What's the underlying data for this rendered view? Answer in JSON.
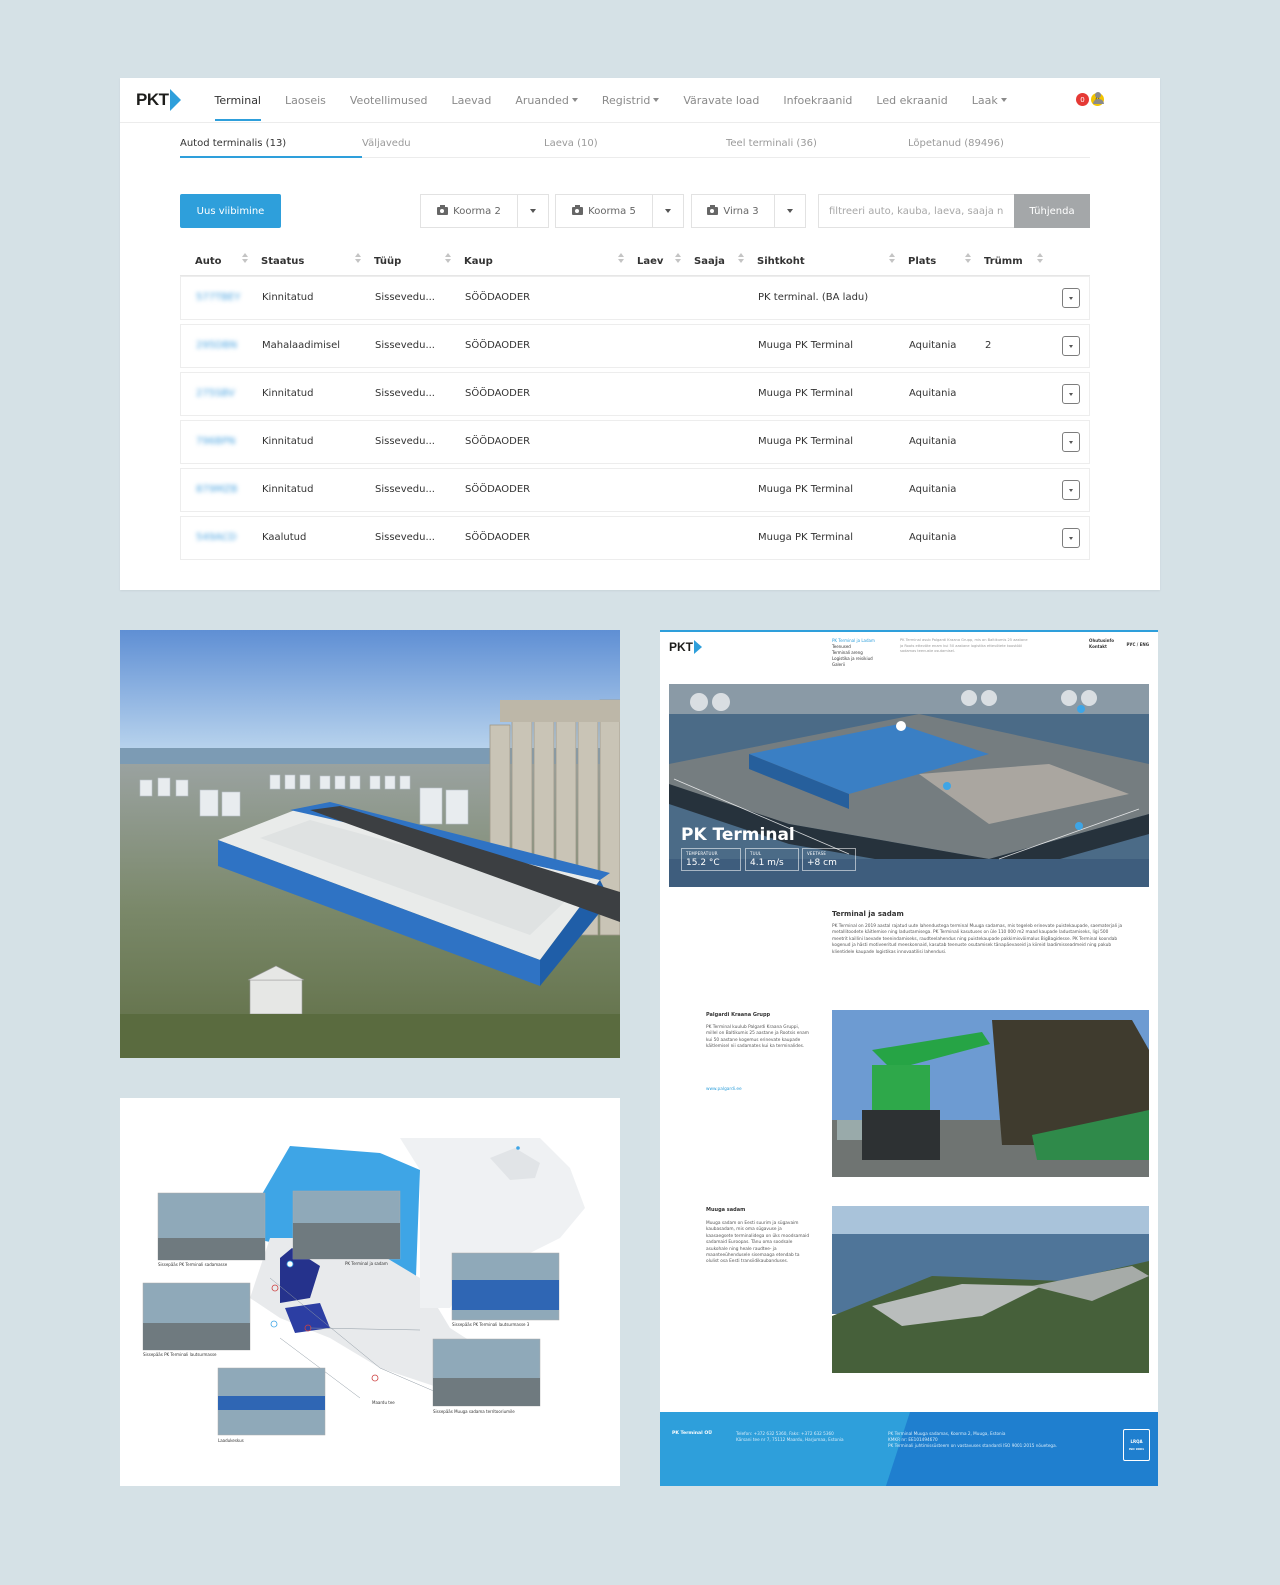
{
  "app": {
    "logo": "PKT",
    "nav": [
      {
        "label": "Terminal",
        "active": true,
        "dropdown": false
      },
      {
        "label": "Laoseis",
        "active": false,
        "dropdown": false
      },
      {
        "label": "Veotellimused",
        "active": false,
        "dropdown": false
      },
      {
        "label": "Laevad",
        "active": false,
        "dropdown": false
      },
      {
        "label": "Aruanded",
        "active": false,
        "dropdown": true
      },
      {
        "label": "Registrid",
        "active": false,
        "dropdown": true
      },
      {
        "label": "Väravate load",
        "active": false,
        "dropdown": false
      },
      {
        "label": "Infoekraanid",
        "active": false,
        "dropdown": false
      },
      {
        "label": "Led ekraanid",
        "active": false,
        "dropdown": false
      },
      {
        "label": "Laak",
        "active": false,
        "dropdown": true
      }
    ],
    "badges": {
      "red": "0",
      "yellow": "0"
    },
    "tabs": [
      {
        "label": "Autod terminalis (13)",
        "active": true
      },
      {
        "label": "Väljavedu",
        "active": false
      },
      {
        "label": "Laeva (10)",
        "active": false
      },
      {
        "label": "Teel terminali (36)",
        "active": false
      },
      {
        "label": "Lõpetanud (89496)",
        "active": false
      }
    ],
    "toolbar": {
      "new_button": "Uus viibimine",
      "splits": [
        "Koorma 2",
        "Koorma 5",
        "Virna 3"
      ],
      "filter_placeholder": "filtreeri auto, kauba, laeva, saaja nime järgi",
      "clear_button": "Tühjenda"
    },
    "table": {
      "columns": [
        "Auto",
        "Staatus",
        "Tüüp",
        "Kaup",
        "Laev",
        "Saaja",
        "Sihtkoht",
        "Plats",
        "Trümm"
      ],
      "rows": [
        {
          "auto": "577TBEY",
          "staatus": "Kinnitatud",
          "tyyp": "Sissevedu...",
          "kaup": "SÖÖDAODER",
          "laev": "",
          "saaja": "",
          "sihtkoht": "PK terminal. (BA ladu)",
          "plats": "",
          "trumm": ""
        },
        {
          "auto": "295DBN",
          "staatus": "Mahalaadimisel",
          "tyyp": "Sissevedu...",
          "kaup": "SÖÖDAODER",
          "laev": "",
          "saaja": "",
          "sihtkoht": "Muuga PK Terminal",
          "plats": "Aquitania",
          "trumm": "2"
        },
        {
          "auto": "275SBV",
          "staatus": "Kinnitatud",
          "tyyp": "Sissevedu...",
          "kaup": "SÖÖDAODER",
          "laev": "",
          "saaja": "",
          "sihtkoht": "Muuga PK Terminal",
          "plats": "Aquitania",
          "trumm": ""
        },
        {
          "auto": "796BPN",
          "staatus": "Kinnitatud",
          "tyyp": "Sissevedu...",
          "kaup": "SÖÖDAODER",
          "laev": "",
          "saaja": "",
          "sihtkoht": "Muuga PK Terminal",
          "plats": "Aquitania",
          "trumm": ""
        },
        {
          "auto": "879MZB",
          "staatus": "Kinnitatud",
          "tyyp": "Sissevedu...",
          "kaup": "SÖÖDAODER",
          "laev": "",
          "saaja": "",
          "sihtkoht": "Muuga PK Terminal",
          "plats": "Aquitania",
          "trumm": ""
        },
        {
          "auto": "549ACD",
          "staatus": "Kaalutud",
          "tyyp": "Sissevedu...",
          "kaup": "SÖÖDAODER",
          "laev": "",
          "saaja": "",
          "sihtkoht": "Muuga PK Terminal",
          "plats": "Aquitania",
          "trumm": ""
        }
      ]
    }
  },
  "map": {
    "captions": [
      "Sissepääs PK Terminali sadamasse",
      "PK Terminal ja sadam",
      "Sissepääs PK Terminali lautsurmasse",
      "Sissepääs PK Terminali lautsurmasse 3",
      "Sissepääs Muuga sadama territooriumile",
      "Maardu tee",
      "Laadukeskus"
    ]
  },
  "site": {
    "logo": "PKT",
    "nav": [
      "PK Terminal ja Ladam",
      "Teenused",
      "Terminali areng",
      "Logistika ja reisikiud",
      "Galerii"
    ],
    "intro": "PK Terminal asub Palgardi Kraana Grupp, mis on Baltikumis 25 aastane ja Roots ettevõte enam kui 50 aastane logistika ettevõtete koostööl sadamas teenuste osutamisel.",
    "top_right": [
      "Ohutusinfo",
      "Kontakt"
    ],
    "lang": "РУС / ENG",
    "hero_title": "PK Terminal",
    "stats": [
      {
        "label": "TEMPERATUUR",
        "value": "15.2 °C"
      },
      {
        "label": "TUUL",
        "value": "4.1 m/s"
      },
      {
        "label": "VEETASE",
        "value": "+8 cm"
      }
    ],
    "sections": [
      {
        "title": "Terminal ja sadam",
        "text": "PK Terminal on 2019 aastal rajatud uute lahendustega terminal Muuga sadamas, mis tegeleb erinevate puistekaupade, saematerjali ja metallitoodete käitlemise ning ladustamisega. PK Terminali kasutuses on üle 110 000 m2 maad kaupade ladustamiseks, ligi 500 meetrit kaillini laevade teenindamiseks, raudteelahendus ning puistekaupade pakkimisvõimalus BigBagidesse. PK Terminal koondab kogenud ja hästi motiveeritud meeskonnaid, kasutab teenuste osutamisek tänapäevaseid ja kiireid laadimisseadmeid ning pakub klientidele kaupade logistikas innovaatilisi lahendusi."
      },
      {
        "title": "Palgardi Kraana Grupp",
        "text": "PK Terminal kuulub Palgardi Kraana Gruppi, millel on Baltikumis 25 aastane ja Rootsis enam kui 50 aastane kogemus erinevate kaupade käitlemisel nii sadamates kui ka terminalides.",
        "link": "www.palgardi.ee"
      },
      {
        "title": "Muuga sadam",
        "text": "Muuga sadam on Eesti suurim ja sügavaim kaubasadam, mis oma sügavuse ja kaasaegsete terminalidega on üks moodsamaid sadamaid Euroopas. Tänu oma soodsale asukohale ning heale raudtee- ja maanteeühendusele sisemaaga etendab ta olulist osa Eesti transiidikaubanduses."
      }
    ],
    "footer": {
      "brand": "PK Terminal OÜ",
      "contact": "Telefon: +372 632 5360, Faks: +372 632 5360\nKärsani tee nr 7, 75112 Maardu, Harjumaa, Estonia",
      "address": "PK Terminal Muuga sadamas, Koorma 2, Muuga, Estonia\nKMKR nr: EE101494670\nPK Terminali juhtimissüsteem on vastavuses standardi ISO 9001:2015 nõuetega.",
      "cert": "LRQA",
      "cert_sub": "ISO 9001"
    }
  }
}
